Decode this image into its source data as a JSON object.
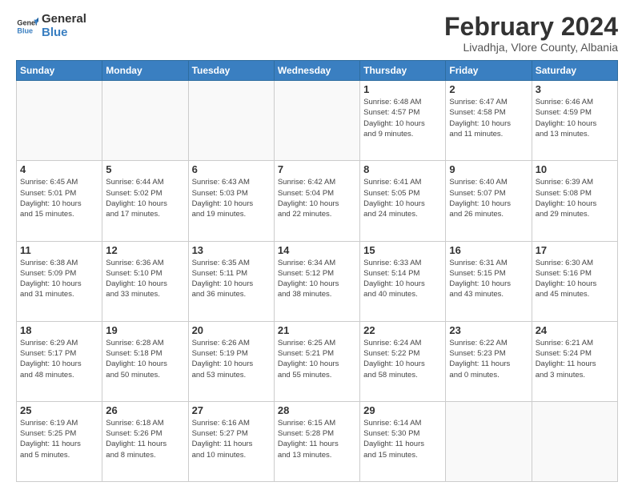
{
  "logo": {
    "line1": "General",
    "line2": "Blue"
  },
  "title": "February 2024",
  "subtitle": "Livadhja, Vlore County, Albania",
  "weekdays": [
    "Sunday",
    "Monday",
    "Tuesday",
    "Wednesday",
    "Thursday",
    "Friday",
    "Saturday"
  ],
  "weeks": [
    [
      {
        "day": "",
        "info": ""
      },
      {
        "day": "",
        "info": ""
      },
      {
        "day": "",
        "info": ""
      },
      {
        "day": "",
        "info": ""
      },
      {
        "day": "1",
        "info": "Sunrise: 6:48 AM\nSunset: 4:57 PM\nDaylight: 10 hours\nand 9 minutes."
      },
      {
        "day": "2",
        "info": "Sunrise: 6:47 AM\nSunset: 4:58 PM\nDaylight: 10 hours\nand 11 minutes."
      },
      {
        "day": "3",
        "info": "Sunrise: 6:46 AM\nSunset: 4:59 PM\nDaylight: 10 hours\nand 13 minutes."
      }
    ],
    [
      {
        "day": "4",
        "info": "Sunrise: 6:45 AM\nSunset: 5:01 PM\nDaylight: 10 hours\nand 15 minutes."
      },
      {
        "day": "5",
        "info": "Sunrise: 6:44 AM\nSunset: 5:02 PM\nDaylight: 10 hours\nand 17 minutes."
      },
      {
        "day": "6",
        "info": "Sunrise: 6:43 AM\nSunset: 5:03 PM\nDaylight: 10 hours\nand 19 minutes."
      },
      {
        "day": "7",
        "info": "Sunrise: 6:42 AM\nSunset: 5:04 PM\nDaylight: 10 hours\nand 22 minutes."
      },
      {
        "day": "8",
        "info": "Sunrise: 6:41 AM\nSunset: 5:05 PM\nDaylight: 10 hours\nand 24 minutes."
      },
      {
        "day": "9",
        "info": "Sunrise: 6:40 AM\nSunset: 5:07 PM\nDaylight: 10 hours\nand 26 minutes."
      },
      {
        "day": "10",
        "info": "Sunrise: 6:39 AM\nSunset: 5:08 PM\nDaylight: 10 hours\nand 29 minutes."
      }
    ],
    [
      {
        "day": "11",
        "info": "Sunrise: 6:38 AM\nSunset: 5:09 PM\nDaylight: 10 hours\nand 31 minutes."
      },
      {
        "day": "12",
        "info": "Sunrise: 6:36 AM\nSunset: 5:10 PM\nDaylight: 10 hours\nand 33 minutes."
      },
      {
        "day": "13",
        "info": "Sunrise: 6:35 AM\nSunset: 5:11 PM\nDaylight: 10 hours\nand 36 minutes."
      },
      {
        "day": "14",
        "info": "Sunrise: 6:34 AM\nSunset: 5:12 PM\nDaylight: 10 hours\nand 38 minutes."
      },
      {
        "day": "15",
        "info": "Sunrise: 6:33 AM\nSunset: 5:14 PM\nDaylight: 10 hours\nand 40 minutes."
      },
      {
        "day": "16",
        "info": "Sunrise: 6:31 AM\nSunset: 5:15 PM\nDaylight: 10 hours\nand 43 minutes."
      },
      {
        "day": "17",
        "info": "Sunrise: 6:30 AM\nSunset: 5:16 PM\nDaylight: 10 hours\nand 45 minutes."
      }
    ],
    [
      {
        "day": "18",
        "info": "Sunrise: 6:29 AM\nSunset: 5:17 PM\nDaylight: 10 hours\nand 48 minutes."
      },
      {
        "day": "19",
        "info": "Sunrise: 6:28 AM\nSunset: 5:18 PM\nDaylight: 10 hours\nand 50 minutes."
      },
      {
        "day": "20",
        "info": "Sunrise: 6:26 AM\nSunset: 5:19 PM\nDaylight: 10 hours\nand 53 minutes."
      },
      {
        "day": "21",
        "info": "Sunrise: 6:25 AM\nSunset: 5:21 PM\nDaylight: 10 hours\nand 55 minutes."
      },
      {
        "day": "22",
        "info": "Sunrise: 6:24 AM\nSunset: 5:22 PM\nDaylight: 10 hours\nand 58 minutes."
      },
      {
        "day": "23",
        "info": "Sunrise: 6:22 AM\nSunset: 5:23 PM\nDaylight: 11 hours\nand 0 minutes."
      },
      {
        "day": "24",
        "info": "Sunrise: 6:21 AM\nSunset: 5:24 PM\nDaylight: 11 hours\nand 3 minutes."
      }
    ],
    [
      {
        "day": "25",
        "info": "Sunrise: 6:19 AM\nSunset: 5:25 PM\nDaylight: 11 hours\nand 5 minutes."
      },
      {
        "day": "26",
        "info": "Sunrise: 6:18 AM\nSunset: 5:26 PM\nDaylight: 11 hours\nand 8 minutes."
      },
      {
        "day": "27",
        "info": "Sunrise: 6:16 AM\nSunset: 5:27 PM\nDaylight: 11 hours\nand 10 minutes."
      },
      {
        "day": "28",
        "info": "Sunrise: 6:15 AM\nSunset: 5:28 PM\nDaylight: 11 hours\nand 13 minutes."
      },
      {
        "day": "29",
        "info": "Sunrise: 6:14 AM\nSunset: 5:30 PM\nDaylight: 11 hours\nand 15 minutes."
      },
      {
        "day": "",
        "info": ""
      },
      {
        "day": "",
        "info": ""
      }
    ]
  ]
}
